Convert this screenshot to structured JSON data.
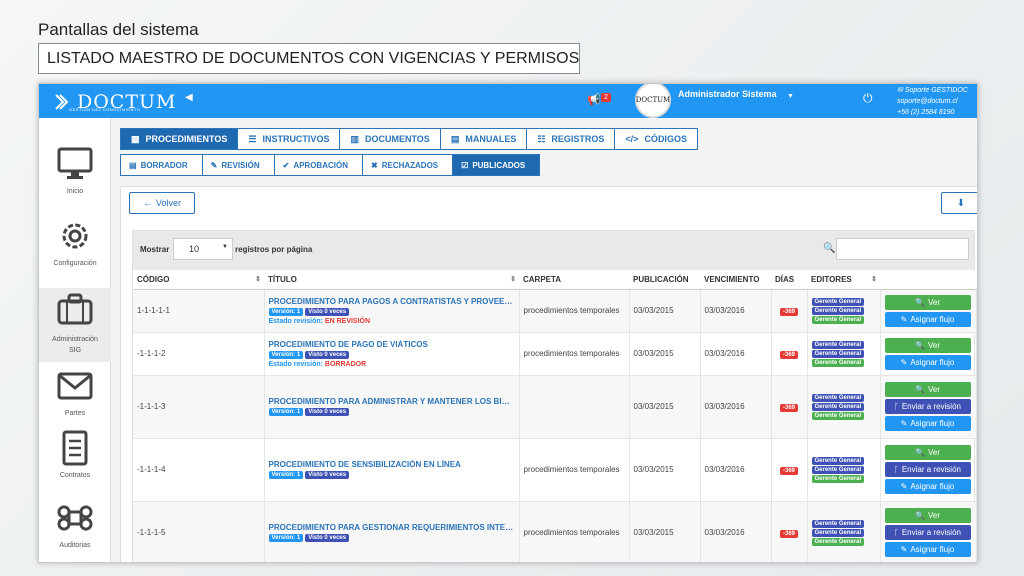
{
  "slide": {
    "title": "Pantallas del sistema",
    "subtitle": "LISTADO MAESTRO DE DOCUMENTOS CON VIGENCIAS Y PERMISOS"
  },
  "topbar": {
    "logo_text": "DOCTUM",
    "logo_sub": "GESTIÓN DEL CONOCIMIENTO",
    "notification_count": "2",
    "avatar_text": "DOCTUM",
    "user_name": "Administrador Sistema",
    "support_title": "Soporte GESTIDOC",
    "support_email": "soporte@doctum.cl",
    "support_phone": "+56 (2) 2584 8190"
  },
  "sidebar": {
    "items": [
      {
        "label": "Inicio",
        "icon": "monitor-icon"
      },
      {
        "label": "Configuración",
        "icon": "gear-icon"
      },
      {
        "label": "Administración SIG",
        "icon": "briefcase-icon"
      },
      {
        "label": "Partes",
        "icon": "envelope-icon"
      },
      {
        "label": "Contratos",
        "icon": "document-icon"
      },
      {
        "label": "Auditorias",
        "icon": "command-icon"
      }
    ]
  },
  "nav_tabs": [
    {
      "label": "PROCEDIMIENTOS",
      "active": true
    },
    {
      "label": "INSTRUCTIVOS"
    },
    {
      "label": "DOCUMENTOS"
    },
    {
      "label": "MANUALES"
    },
    {
      "label": "REGISTROS"
    },
    {
      "label": "CÓDIGOS"
    }
  ],
  "steps": [
    {
      "label": "BORRADOR"
    },
    {
      "label": "REVISIÓN"
    },
    {
      "label": "APROBACIÓN"
    },
    {
      "label": "RECHAZADOS"
    },
    {
      "label": "PUBLICADOS",
      "active": true
    }
  ],
  "toolbar": {
    "back_label": "Volver"
  },
  "table_controls": {
    "show_label": "Mostrar",
    "page_size": "10",
    "records_label": "registros por página"
  },
  "columns": [
    "CÓDIGO",
    "TÍTULO",
    "CARPETA",
    "PUBLICACIÓN",
    "VENCIMIENTO",
    "DÍAS",
    "EDITORES"
  ],
  "rows": [
    {
      "code": "1-1-1-1-1",
      "title": "PROCEDIMIENTO PARA PAGOS A CONTRATISTAS Y PROVEEDO...",
      "version": "Versión: 1",
      "views": "Visto 0 veces",
      "estado_label": "Estado revisión:",
      "estado_value": "EN REVISIÓN",
      "folder": "procedimientos temporales",
      "published": "03/03/2015",
      "expires": "03/03/2016",
      "days": "-369",
      "editors": [
        "Gerente General",
        "Gerente General",
        "Gerente General"
      ],
      "actions": [
        "Ver",
        "Asignar flujo"
      ]
    },
    {
      "code": "-1-1-1-2",
      "title": "PROCEDIMIENTO DE PAGO DE VIÁTICOS",
      "version": "Versión: 1",
      "views": "Visto 0 veces",
      "estado_label": "Estado revisión:",
      "estado_value": "BORRADOR",
      "folder": "procedimientos temporales",
      "published": "03/03/2015",
      "expires": "03/03/2016",
      "days": "-369",
      "editors": [
        "Gerente General",
        "Gerente General",
        "Gerente General"
      ],
      "actions": [
        "Ver",
        "Asignar flujo"
      ]
    },
    {
      "code": "-1-1-1-3",
      "title": "PROCEDIMIENTO PARA ADMINISTRAR Y MANTENER LOS BIEN...",
      "version": "Versión: 1",
      "views": "Visto 0 veces",
      "folder": "",
      "published": "03/03/2015",
      "expires": "03/03/2016",
      "days": "-369",
      "editors": [
        "Gerente General",
        "Gerente General",
        "Gerente General"
      ],
      "actions": [
        "Ver",
        "Enviar a revisión",
        "Asignar flujo"
      ]
    },
    {
      "code": "-1-1-1-4",
      "title": "PROCEDIMIENTO DE SENSIBILIZACIÓN EN LÍNEA",
      "version": "Versión: 1",
      "views": "Visto 0 veces",
      "folder": "procedimientos temporales",
      "published": "03/03/2015",
      "expires": "03/03/2016",
      "days": "-369",
      "editors": [
        "Gerente General",
        "Gerente General",
        "Gerente General"
      ],
      "actions": [
        "Ver",
        "Enviar a revisión",
        "Asignar flujo"
      ]
    },
    {
      "code": "-1-1-1-5",
      "title": "PROCEDIMIENTO PARA GESTIONAR REQUERIMIENTOS INTERN...",
      "version": "Versión: 1",
      "views": "Visto 0 veces",
      "folder": "procedimientos temporales",
      "published": "03/03/2015",
      "expires": "03/03/2016",
      "days": "-369",
      "editors": [
        "Gerente General",
        "Gerente General",
        "Gerente General"
      ],
      "actions": [
        "Ver",
        "Enviar a revisión",
        "Asignar flujo"
      ]
    }
  ],
  "colors": {
    "topbar": "#2196f3",
    "nav_active": "#1f69b1",
    "btn_green": "#4caf50",
    "btn_blue": "#2196f3",
    "btn_navy": "#3f51b5",
    "danger": "#e53935"
  }
}
